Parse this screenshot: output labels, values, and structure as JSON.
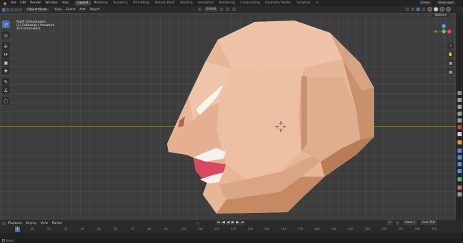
{
  "topbar": {
    "menus": [
      "File",
      "Edit",
      "Render",
      "Window",
      "Help"
    ],
    "workspaces": [
      "Layout",
      "Modeling",
      "Sculpting",
      "UV Editing",
      "Texture Paint",
      "Shading",
      "Animation",
      "Rendering",
      "Compositing",
      "Geometry Nodes",
      "Scripting"
    ],
    "active_workspace": "Layout",
    "scene": "Scene",
    "view_layer": "ViewLayer"
  },
  "header": {
    "mode": "Object Mode",
    "menus": [
      "View",
      "Select",
      "Add",
      "Object"
    ],
    "transform_orientation": "Global",
    "options": "Options"
  },
  "viewport": {
    "view_name": "Right Orthographic",
    "collection": "(1) Collection | Armature",
    "units": "10 Centimeters"
  },
  "toolbar": {
    "tools": [
      "select-box",
      "cursor",
      "move",
      "rotate",
      "scale",
      "transform",
      "annotate",
      "measure",
      "add-cube"
    ]
  },
  "timeline": {
    "menus": [
      "Playback",
      "Keying",
      "View",
      "Marker"
    ],
    "current_frame": "1",
    "start_label": "Start",
    "start": "1",
    "end_label": "End",
    "end": "250",
    "ruler_ticks": [
      "0",
      "10",
      "20",
      "30",
      "40",
      "50",
      "60",
      "70",
      "80",
      "90",
      "100",
      "110",
      "120",
      "130",
      "140",
      "150",
      "160",
      "170",
      "180",
      "190",
      "200",
      "210",
      "220",
      "230",
      "240",
      "250"
    ]
  },
  "statusbar": {
    "left_text": "Select"
  },
  "colors": {
    "accent": "#4772b3",
    "viewport_bg": "#3d3d3d",
    "skin_light": "#f0c7ad",
    "skin_shadow": "#c48a5e",
    "mouth": "#d8485e"
  }
}
